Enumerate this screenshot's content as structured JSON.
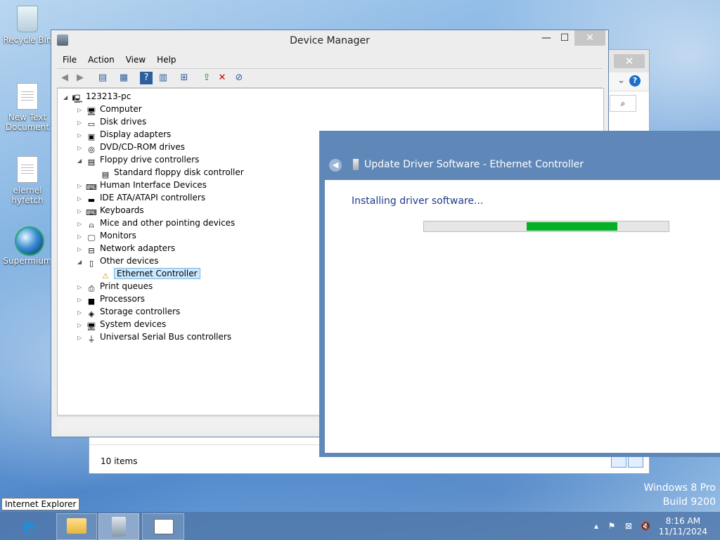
{
  "desktop": {
    "icons": [
      {
        "label": "Recycle Bin"
      },
      {
        "label": "New Text Document"
      },
      {
        "label": "elernel hyfetch"
      },
      {
        "label": "Supermium"
      }
    ],
    "watermark": {
      "line1": "Windows 8 Pro",
      "line2": "Build 9200"
    }
  },
  "explorer_back": {
    "close_glyph": "✕",
    "status": "10 items"
  },
  "device_manager": {
    "title": "Device Manager",
    "window_controls": {
      "minimize": "—",
      "maximize": "☐",
      "close": "✕"
    },
    "menu": [
      "File",
      "Action",
      "View",
      "Help"
    ],
    "tree": {
      "root": "123213-pc",
      "items": [
        {
          "label": "Computer",
          "expanded": false,
          "icon": "computer-icon"
        },
        {
          "label": "Disk drives",
          "expanded": false,
          "icon": "disk-icon"
        },
        {
          "label": "Display adapters",
          "expanded": false,
          "icon": "display-icon"
        },
        {
          "label": "DVD/CD-ROM drives",
          "expanded": false,
          "icon": "dvd-icon"
        },
        {
          "label": "Floppy drive controllers",
          "expanded": true,
          "icon": "floppy-icon"
        },
        {
          "label": "Standard floppy disk controller",
          "child": true,
          "icon": "floppy-icon"
        },
        {
          "label": "Human Interface Devices",
          "expanded": false,
          "icon": "hid-icon"
        },
        {
          "label": "IDE ATA/ATAPI controllers",
          "expanded": false,
          "icon": "ide-icon"
        },
        {
          "label": "Keyboards",
          "expanded": false,
          "icon": "keyboard-icon"
        },
        {
          "label": "Mice and other pointing devices",
          "expanded": false,
          "icon": "mouse-icon"
        },
        {
          "label": "Monitors",
          "expanded": false,
          "icon": "monitor-icon"
        },
        {
          "label": "Network adapters",
          "expanded": false,
          "icon": "network-icon"
        },
        {
          "label": "Other devices",
          "expanded": true,
          "icon": "other-devices-icon"
        },
        {
          "label": "Ethernet Controller",
          "child": true,
          "selected": true,
          "icon": "warning-icon"
        },
        {
          "label": "Print queues",
          "expanded": false,
          "icon": "printer-icon"
        },
        {
          "label": "Processors",
          "expanded": false,
          "icon": "processor-icon"
        },
        {
          "label": "Storage controllers",
          "expanded": false,
          "icon": "storage-icon"
        },
        {
          "label": "System devices",
          "expanded": false,
          "icon": "system-icon"
        },
        {
          "label": "Universal Serial Bus controllers",
          "expanded": false,
          "icon": "usb-icon"
        }
      ]
    }
  },
  "update_dialog": {
    "title": "Update Driver Software - Ethernet Controller",
    "message": "Installing driver software...",
    "progress_marquee": {
      "start": 0.42,
      "end": 0.79
    }
  },
  "taskbar": {
    "tooltip": "Internet Explorer",
    "clock_time": "8:16 AM",
    "clock_date": "11/11/2024"
  },
  "colors": {
    "accent": "#5f88b8",
    "progress": "#06b025",
    "link_text": "#1e3a8a"
  }
}
